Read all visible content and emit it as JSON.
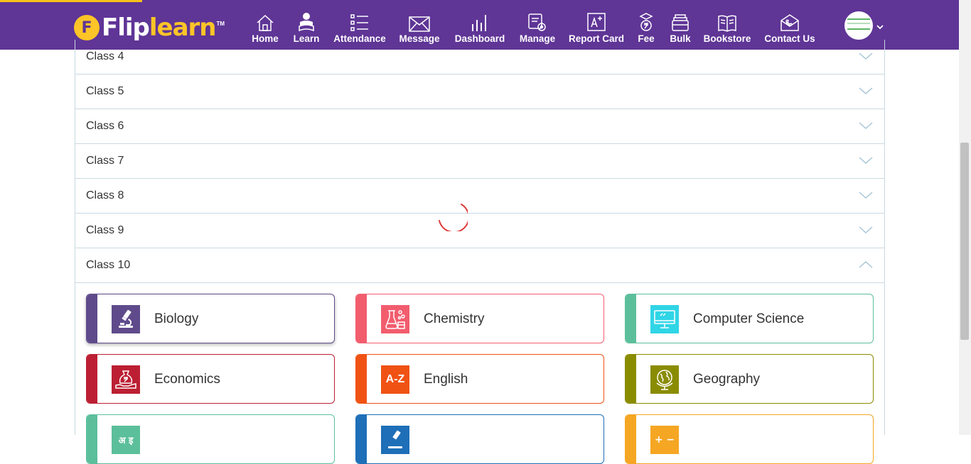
{
  "brand": {
    "logo_mark": "F",
    "logo_part1": "Flip",
    "logo_part2": "learn",
    "logo_tm": "TM",
    "primary_color": "#5f3596",
    "accent_color": "#fdc527"
  },
  "nav": [
    {
      "label": "Home",
      "icon": "home-icon"
    },
    {
      "label": "Learn",
      "icon": "learn-icon"
    },
    {
      "label": "Attendance",
      "icon": "attendance-icon"
    },
    {
      "label": "Message",
      "icon": "message-icon"
    },
    {
      "label": "Dashboard",
      "icon": "dashboard-icon"
    },
    {
      "label": "Manage",
      "icon": "manage-icon"
    },
    {
      "label": "Report Card",
      "icon": "report-card-icon"
    },
    {
      "label": "Fee",
      "icon": "fee-icon"
    },
    {
      "label": "Bulk",
      "icon": "bulk-icon"
    },
    {
      "label": "Bookstore",
      "icon": "bookstore-icon"
    },
    {
      "label": "Contact Us",
      "icon": "contact-icon"
    }
  ],
  "classes": [
    {
      "label": "Class 4",
      "expanded": false
    },
    {
      "label": "Class 5",
      "expanded": false
    },
    {
      "label": "Class 6",
      "expanded": false
    },
    {
      "label": "Class 7",
      "expanded": false
    },
    {
      "label": "Class 8",
      "expanded": false
    },
    {
      "label": "Class 9",
      "expanded": false
    },
    {
      "label": "Class 10",
      "expanded": true
    }
  ],
  "subjects": [
    {
      "name": "Biology",
      "color": "#5f4b8b",
      "icon": "microscope-icon",
      "selected": true
    },
    {
      "name": "Chemistry",
      "color": "#f25d6e",
      "icon": "flask-icon",
      "selected": false
    },
    {
      "name": "Computer Science",
      "color": "#5cbf9b",
      "icon": "monitor-icon",
      "selected": false
    },
    {
      "name": "Economics",
      "color": "#bc1f33",
      "icon": "money-bag-icon",
      "selected": false
    },
    {
      "name": "English",
      "color": "#f05214",
      "icon": "alphabet-icon",
      "icon_text": "A-Z",
      "selected": false
    },
    {
      "name": "Geography",
      "color": "#8a8c00",
      "icon": "globe-icon",
      "selected": false
    },
    {
      "name": "",
      "color": "#5cbf9b",
      "icon": "hindi-icon",
      "icon_text": "अ इ",
      "selected": false
    },
    {
      "name": "",
      "color": "#1e6fb8",
      "icon": "science-icon",
      "selected": false
    },
    {
      "name": "",
      "color": "#f5a623",
      "icon": "math-icon",
      "icon_text": "+ −",
      "selected": false
    }
  ],
  "spinner_color": "#e03a3a"
}
